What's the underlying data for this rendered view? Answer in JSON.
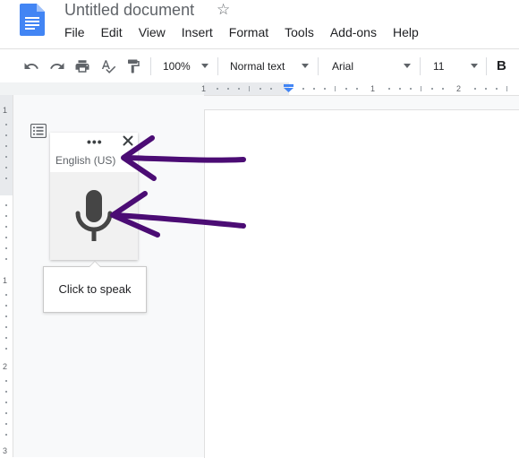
{
  "header": {
    "title": "Untitled document",
    "star_icon": "star-outline-icon",
    "menu": [
      "File",
      "Edit",
      "View",
      "Insert",
      "Format",
      "Tools",
      "Add-ons",
      "Help"
    ]
  },
  "toolbar": {
    "zoom": "100%",
    "style": "Normal text",
    "font": "Arial",
    "font_size": "11",
    "bold": "B",
    "icons": [
      "undo-icon",
      "redo-icon",
      "print-icon",
      "spellcheck-icon",
      "paint-format-icon"
    ]
  },
  "ruler": {
    "horizontal_numbers": [
      "1",
      "1",
      "2"
    ],
    "vertical_numbers": [
      "1",
      "1",
      "2",
      "3"
    ]
  },
  "voice_typing": {
    "more_icon": "•••",
    "language": "English (US)",
    "tooltip": "Click to speak",
    "mic_icon": "microphone-icon"
  },
  "annotation": {
    "arrow_color": "#4b0c74"
  },
  "colors": {
    "docs_blue": "#4285f4",
    "canvas_gray": "#f8f9fa"
  }
}
